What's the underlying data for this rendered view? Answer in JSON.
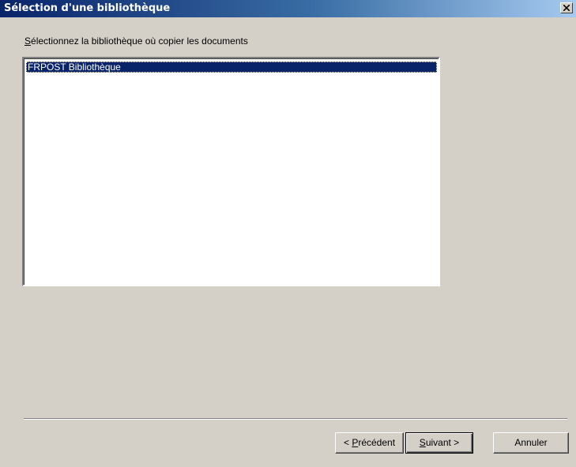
{
  "window": {
    "title": "Sélection d'une bibliothèque",
    "close_icon": "close-icon"
  },
  "instruction": {
    "accel": "S",
    "rest": "électionnez la bibliothèque où copier les documents"
  },
  "library_list": {
    "items": [
      {
        "label": "FRPOST Bibliothèque",
        "selected": true
      }
    ]
  },
  "buttons": {
    "previous": {
      "prefix": "< ",
      "accel": "P",
      "rest": "récédent"
    },
    "next": {
      "accel": "S",
      "rest": "uivant >"
    },
    "cancel": "Annuler"
  },
  "colors": {
    "dialog_bg": "#d4d0c8",
    "selection": "#0a246a",
    "title_gradient_start": "#0a246a"
  }
}
